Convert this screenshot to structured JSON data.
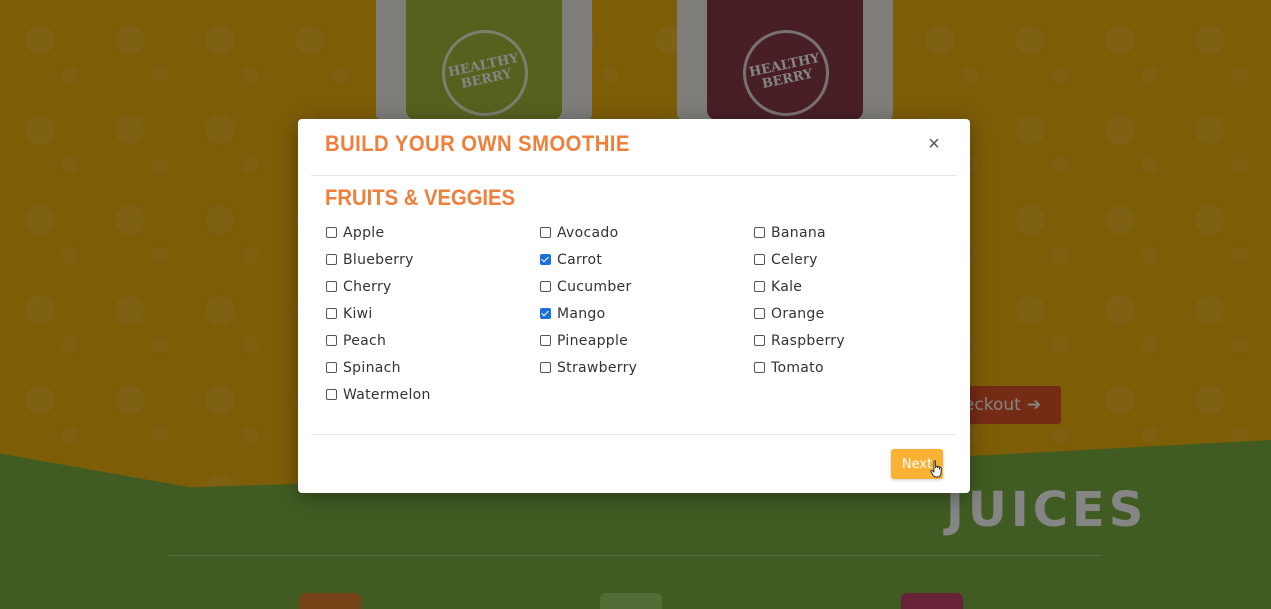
{
  "background": {
    "cups": [
      {
        "logo": "HEALTHY BERRY",
        "liquid_color": "#a4bd3a"
      },
      {
        "logo": "HEALTHY BERRY",
        "liquid_color": "#8d3d4a"
      }
    ],
    "checkout_button": "eckout",
    "juices_heading": "JUICES",
    "jar_colors": [
      "#e0802a",
      "#9cd36a",
      "#c9446e"
    ],
    "colors": {
      "orange": "#f2b30f",
      "green": "#7bb142"
    }
  },
  "modal": {
    "title": "BUILD YOUR OWN SMOOTHIE",
    "close_label": "×",
    "section_title": "FRUITS & VEGGIES",
    "items": [
      {
        "label": "Apple",
        "checked": false
      },
      {
        "label": "Avocado",
        "checked": false
      },
      {
        "label": "Banana",
        "checked": false
      },
      {
        "label": "Blueberry",
        "checked": false
      },
      {
        "label": "Carrot",
        "checked": true
      },
      {
        "label": "Celery",
        "checked": false
      },
      {
        "label": "Cherry",
        "checked": false
      },
      {
        "label": "Cucumber",
        "checked": false
      },
      {
        "label": "Kale",
        "checked": false
      },
      {
        "label": "Kiwi",
        "checked": false
      },
      {
        "label": "Mango",
        "checked": true
      },
      {
        "label": "Orange",
        "checked": false
      },
      {
        "label": "Peach",
        "checked": false
      },
      {
        "label": "Pineapple",
        "checked": false
      },
      {
        "label": "Raspberry",
        "checked": false
      },
      {
        "label": "Spinach",
        "checked": false
      },
      {
        "label": "Strawberry",
        "checked": false
      },
      {
        "label": "Tomato",
        "checked": false
      },
      {
        "label": "Watermelon",
        "checked": false
      }
    ],
    "next_label": "Next",
    "colors": {
      "accent": "#f07f3c",
      "button": "#f9b233",
      "checkbox_checked": "#1a6fd8"
    }
  }
}
